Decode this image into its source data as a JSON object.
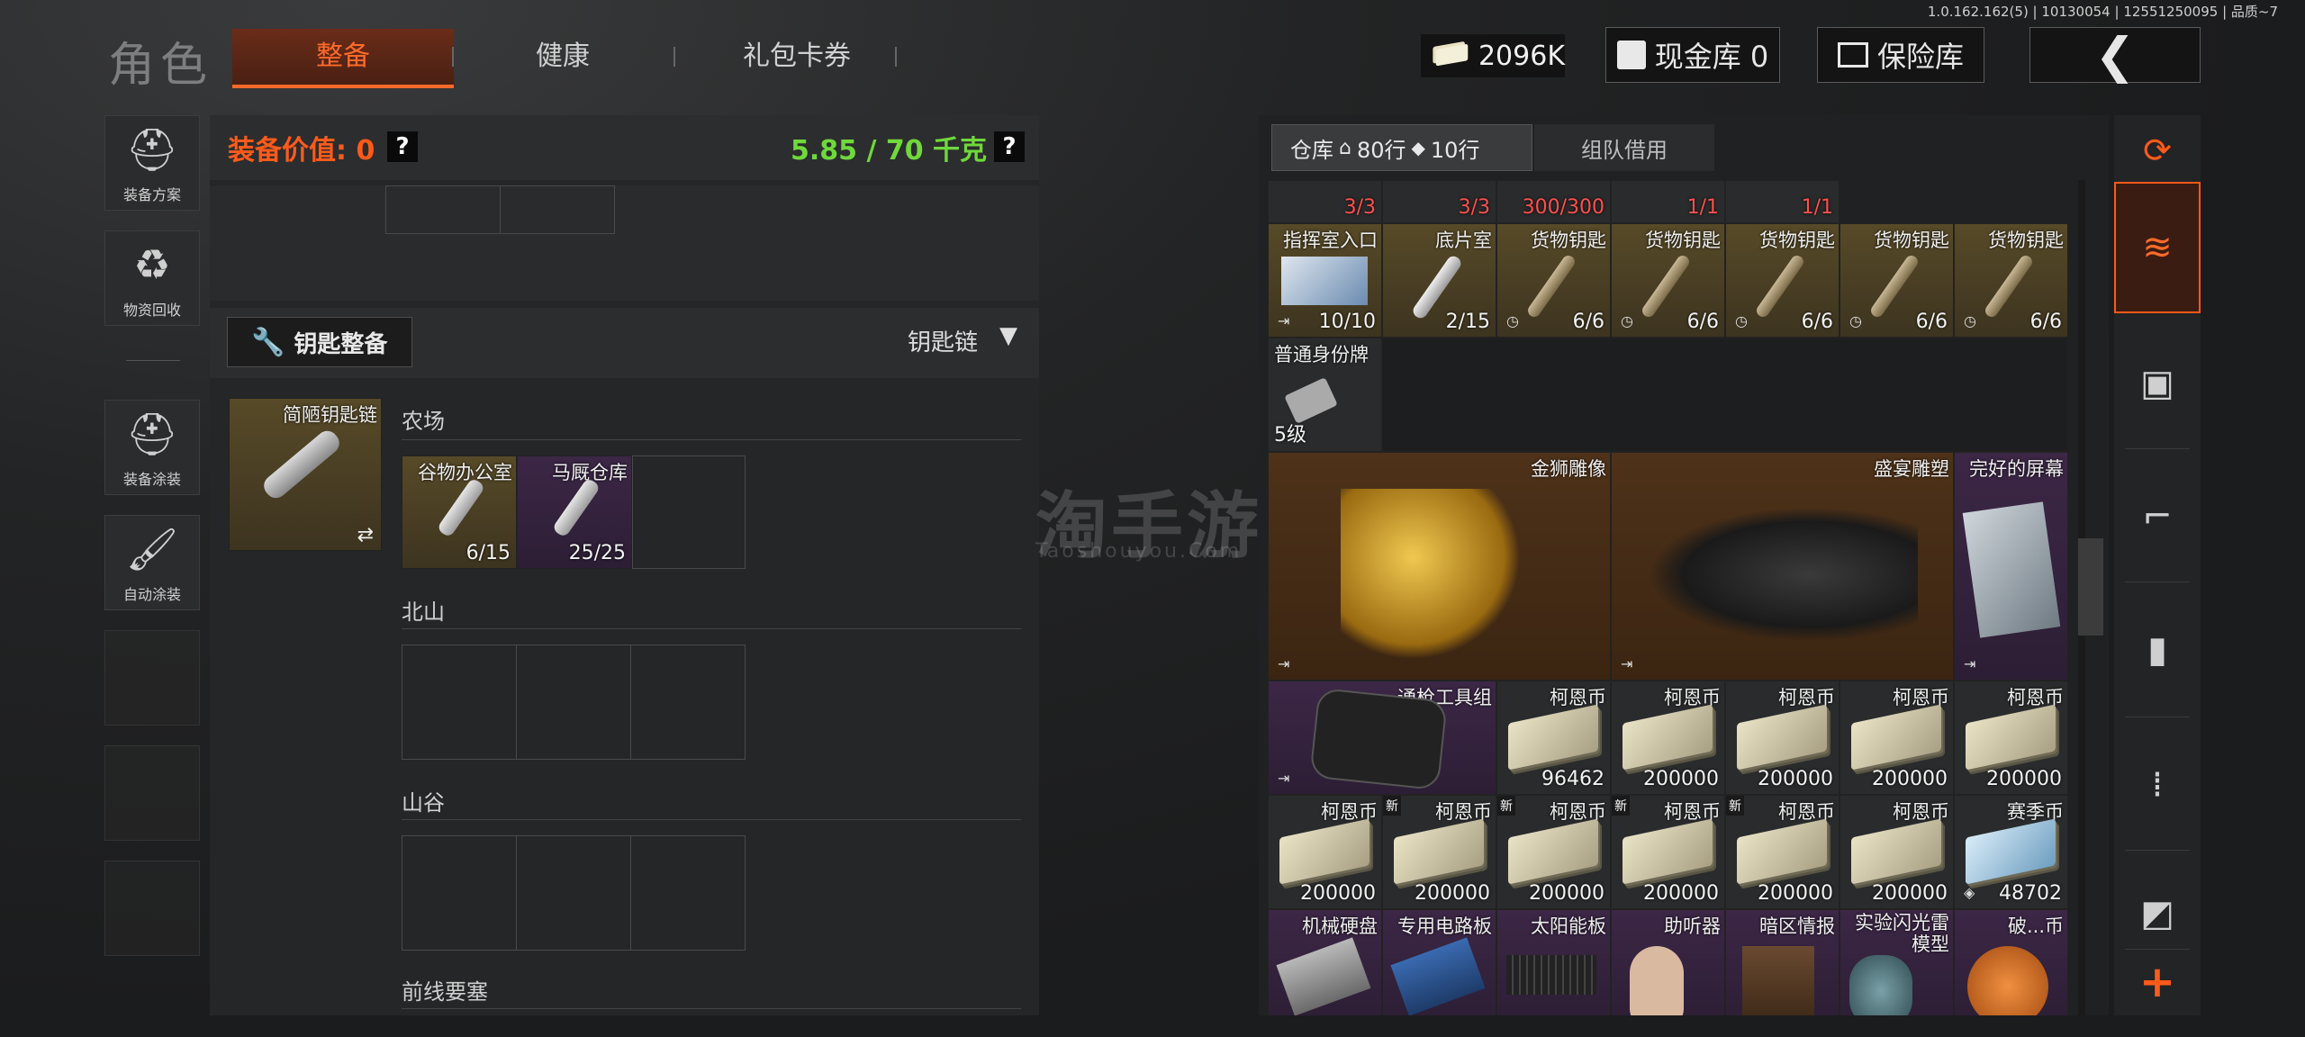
{
  "header": {
    "title": "角色",
    "tabs": [
      "整备",
      "健康",
      "礼包卡券"
    ],
    "version": "1.0.162.162(5) | 10130054 | 12551250095 | 品质~7",
    "money": "2096K",
    "cash_vault": "现金库 0",
    "safe_box": "保险库"
  },
  "sidebar": {
    "items": [
      "装备方案",
      "物资回收",
      "装备涂装",
      "自动涂装"
    ]
  },
  "equipment": {
    "value_label": "装备价值: 0",
    "weight": "5.85 / 70 千克",
    "help": "?"
  },
  "keychain": {
    "button_label": "钥匙整备",
    "dropdown_label": "钥匙链",
    "chain_name": "简陋钥匙链",
    "sections": [
      {
        "name": "农场",
        "keys": [
          {
            "name": "谷物办公室",
            "count": "6/15"
          },
          {
            "name": "马厩仓库",
            "count": "25/25"
          }
        ]
      },
      {
        "name": "北山",
        "keys": []
      },
      {
        "name": "山谷",
        "keys": []
      },
      {
        "name": "前线要塞",
        "keys": []
      }
    ]
  },
  "warehouse": {
    "tab_label": "仓库",
    "rows_home": "80行",
    "rows_extra": "10行",
    "team_tab": "组队借用",
    "top_row_counts": [
      "3/3",
      "3/3",
      "300/300",
      "1/1",
      "1/1"
    ],
    "rows": [
      [
        {
          "name": "指挥室入口",
          "count": "10/10",
          "rarity": "gold"
        },
        {
          "name": "底片室",
          "count": "2/15",
          "rarity": "gold"
        },
        {
          "name": "货物钥匙",
          "count": "6/6",
          "rarity": "gold"
        },
        {
          "name": "货物钥匙",
          "count": "6/6",
          "rarity": "gold"
        },
        {
          "name": "货物钥匙",
          "count": "6/6",
          "rarity": "gold"
        },
        {
          "name": "货物钥匙",
          "count": "6/6",
          "rarity": "gold"
        },
        {
          "name": "货物钥匙",
          "count": "6/6",
          "rarity": "gold"
        }
      ],
      [
        {
          "name": "普通身份牌",
          "count": "5级",
          "rarity": "gray"
        }
      ],
      [
        {
          "name": "金狮雕像",
          "rarity": "brown"
        },
        {
          "name": "盛宴雕塑",
          "rarity": "brown"
        },
        {
          "name": "完好的屏幕",
          "rarity": "purple"
        }
      ],
      [
        {
          "name": "通枪工具组",
          "rarity": "purple"
        },
        {
          "name": "柯恩币",
          "count": "96462"
        },
        {
          "name": "柯恩币",
          "count": "200000"
        },
        {
          "name": "柯恩币",
          "count": "200000"
        },
        {
          "name": "柯恩币",
          "count": "200000"
        },
        {
          "name": "柯恩币",
          "count": "200000"
        }
      ],
      [
        {
          "name": "柯恩币",
          "count": "200000"
        },
        {
          "name": "柯恩币",
          "count": "200000",
          "badge": "新"
        },
        {
          "name": "柯恩币",
          "count": "200000",
          "badge": "新"
        },
        {
          "name": "柯恩币",
          "count": "200000",
          "badge": "新"
        },
        {
          "name": "柯恩币",
          "count": "200000",
          "badge": "新"
        },
        {
          "name": "柯恩币",
          "count": "200000"
        },
        {
          "name": "赛季币",
          "count": "48702"
        }
      ],
      [
        {
          "name": "机械硬盘",
          "rarity": "purple"
        },
        {
          "name": "专用电路板",
          "rarity": "purple"
        },
        {
          "name": "太阳能板",
          "rarity": "purple"
        },
        {
          "name": "助听器",
          "rarity": "purple"
        },
        {
          "name": "暗区情报",
          "rarity": "purple"
        },
        {
          "name": "实验闪光雷模型",
          "rarity": "purple"
        },
        {
          "name": "破...币",
          "rarity": "purple"
        }
      ]
    ]
  },
  "watermark": {
    "cn": "淘手游",
    "en": "Taoshouyou.Com"
  },
  "colors": {
    "accent": "#ff6a2a",
    "weight_ok": "#6fd83c",
    "gold": "#574a28",
    "purple": "#3c2746"
  }
}
